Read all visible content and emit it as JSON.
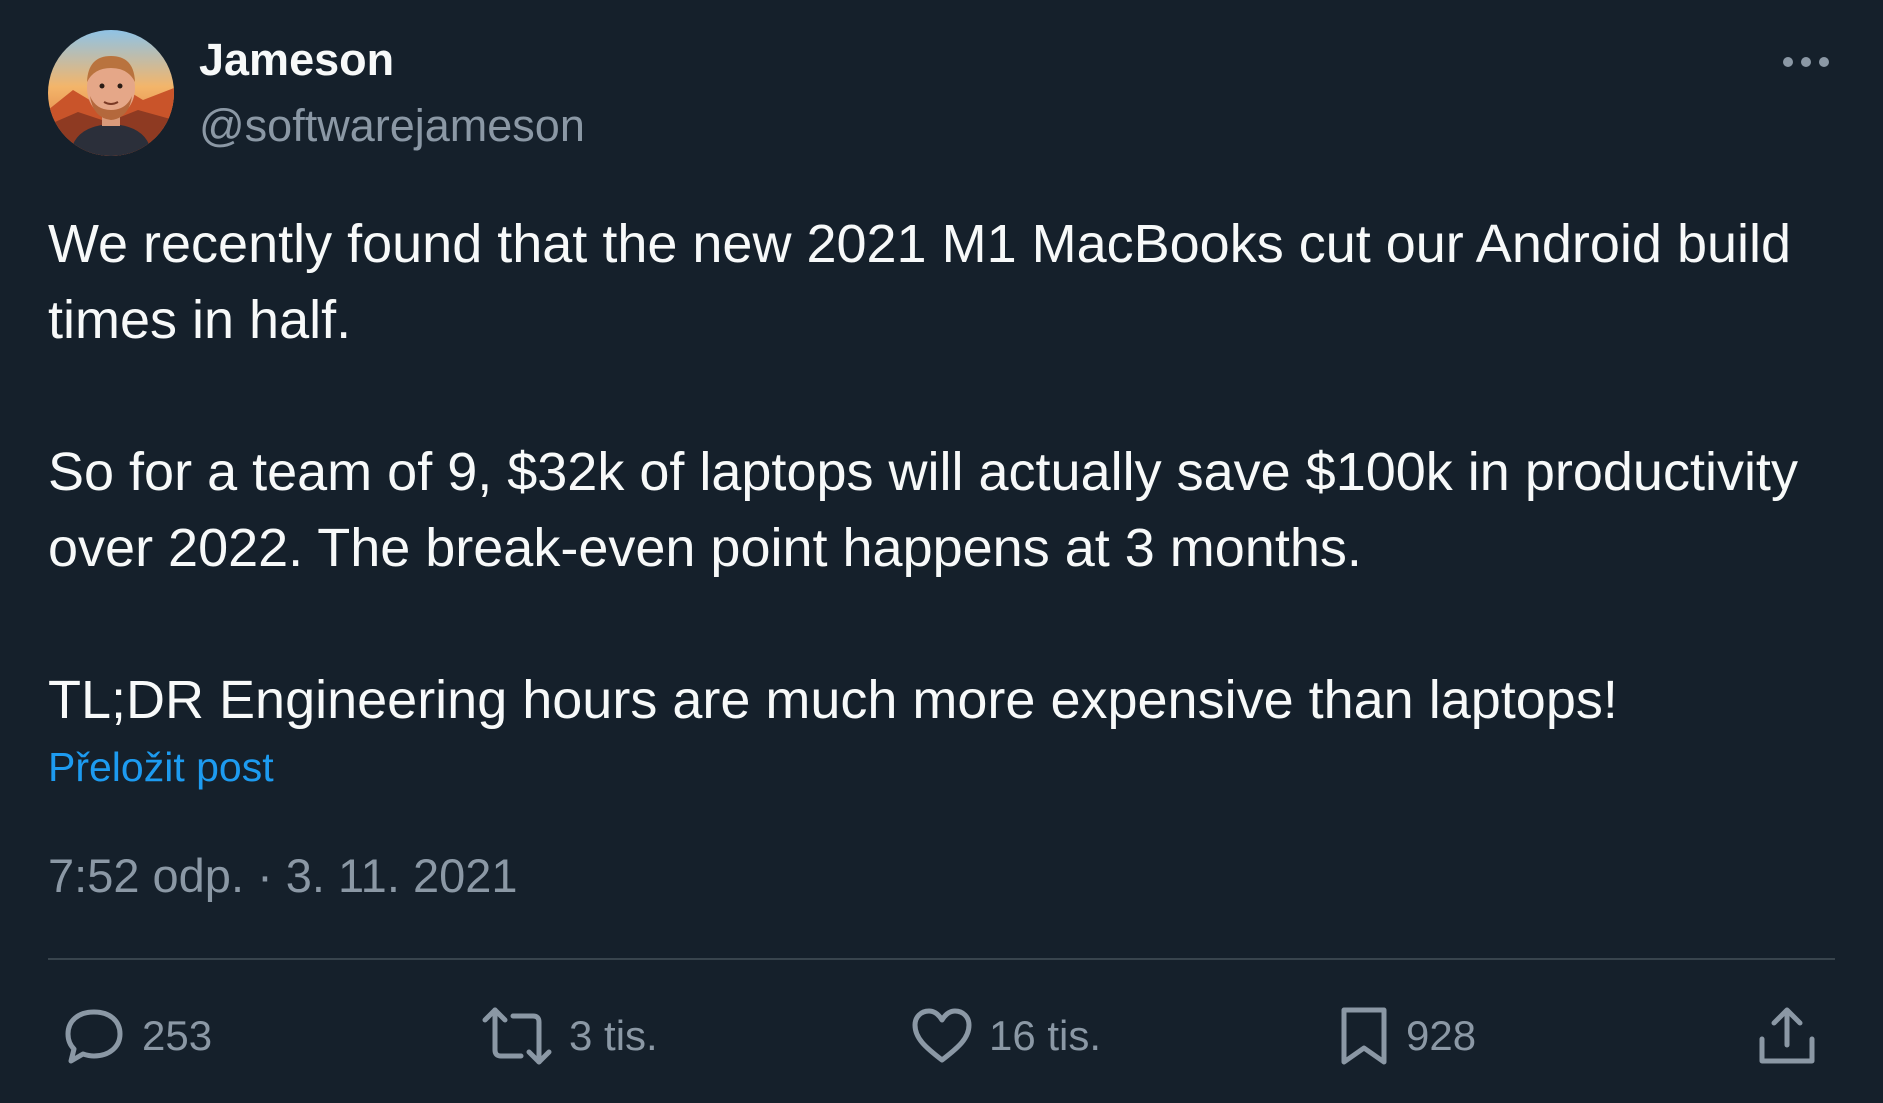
{
  "author": {
    "display_name": "Jameson",
    "handle": "@softwarejameson"
  },
  "post": {
    "paragraphs": [
      "We recently found that the new 2021 M1 MacBooks cut our Android build times in half.",
      "So for a team of 9, $32k of laptops will actually save $100k in productivity over 2022. The break-even point happens at 3 months.",
      "TL;DR Engineering hours are much more expensive than laptops!"
    ],
    "translate_label": "Přeložit post",
    "timestamp": "7:52 odp. · 3. 11. 2021"
  },
  "actions": {
    "reply": {
      "icon": "reply-icon",
      "count": "253"
    },
    "repost": {
      "icon": "repost-icon",
      "count": "3 tis."
    },
    "like": {
      "icon": "heart-icon",
      "count": "16 tis."
    },
    "bookmark": {
      "icon": "bookmark-icon",
      "count": "928"
    },
    "share": {
      "icon": "share-icon"
    }
  },
  "colors": {
    "background": "#15202b",
    "primary_text": "#f7f9f9",
    "secondary_text": "#8b98a5",
    "link": "#1d9bf0",
    "divider": "#38444d"
  }
}
